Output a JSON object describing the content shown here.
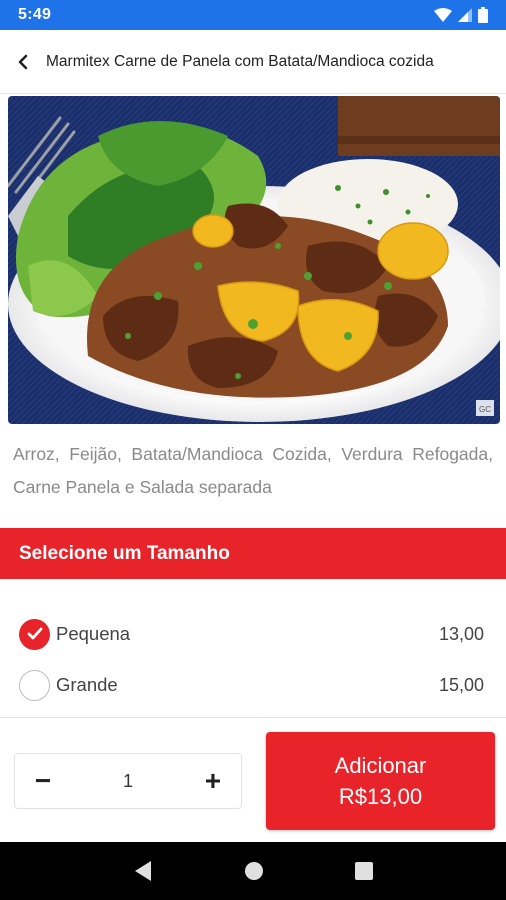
{
  "status_bar": {
    "time": "5:49",
    "icons": [
      "wifi-icon",
      "signal-icon",
      "battery-icon"
    ]
  },
  "app_bar": {
    "back_icon": "chevron-left-icon",
    "title": "Marmitex Carne de Panela com Batata/Mandioca cozida"
  },
  "product": {
    "image_alt": "Prato de carne de panela com batata, arroz e salada",
    "image_badge": "GC",
    "description": "Arroz, Feijão, Batata/Mandioca Cozida, Verdura Refogada, Carne Panela e Salada separada"
  },
  "size_section": {
    "title": "Selecione um Tamanho",
    "options": [
      {
        "label": "Pequena",
        "price": "13,00",
        "selected": true
      },
      {
        "label": "Grande",
        "price": "15,00",
        "selected": false
      }
    ]
  },
  "quantity": {
    "minus": "−",
    "value": "1",
    "plus": "+"
  },
  "add_button": {
    "line1": "Adicionar",
    "line2": "R$13,00"
  },
  "nav_bar": {
    "icons": [
      "back-triangle-icon",
      "home-circle-icon",
      "recents-square-icon"
    ]
  },
  "colors": {
    "status_bar": "#1e73e8",
    "accent": "#e8232a",
    "nav_bar": "#000000"
  }
}
